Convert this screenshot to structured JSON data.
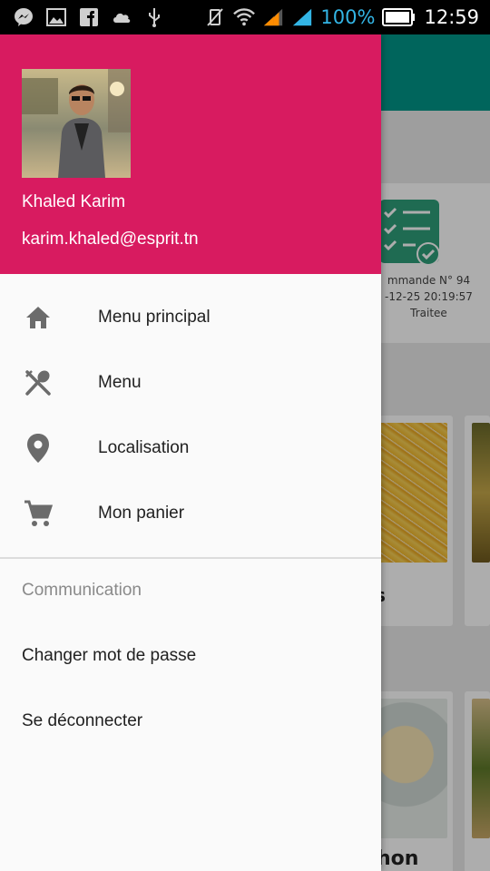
{
  "status_bar": {
    "battery_percent": "100%",
    "time": "12:59",
    "icons": [
      "messenger-icon",
      "image-icon",
      "facebook-icon",
      "weather-icon",
      "usb-icon",
      "mute-icon",
      "wifi-icon",
      "signal-icon",
      "signal2-icon",
      "battery-icon"
    ],
    "battery_level": 1.0,
    "accent_color": "#33b5e5"
  },
  "drawer": {
    "header_color": "#d81b60",
    "user": {
      "name": "Khaled Karim",
      "email": "karim.khaled@esprit.tn"
    },
    "items": [
      {
        "label": "Menu principal",
        "icon": "home-icon"
      },
      {
        "label": "Menu",
        "icon": "utensils-icon"
      },
      {
        "label": "Localisation",
        "icon": "location-pin-icon"
      },
      {
        "label": "Mon panier",
        "icon": "cart-icon"
      }
    ],
    "section": {
      "title": "Communication",
      "items": [
        {
          "label": "Changer mot de passe"
        },
        {
          "label": "Se déconnecter"
        }
      ]
    }
  },
  "background": {
    "toolbar_color": "#009688",
    "order": {
      "line1": "mmande N° 94",
      "line2": "-12-25 20:19:57",
      "line3": "Traitee"
    },
    "food_labels": {
      "first": "s",
      "second": "hon"
    }
  }
}
